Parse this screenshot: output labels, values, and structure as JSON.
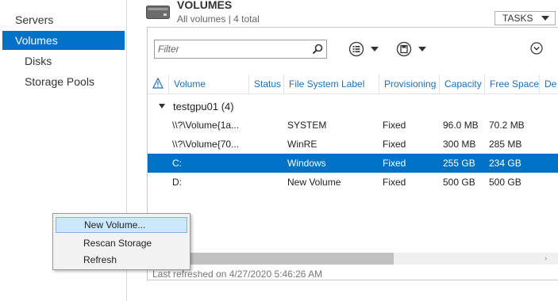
{
  "sidebar": {
    "items": [
      {
        "label": "Servers"
      },
      {
        "label": "Volumes"
      },
      {
        "label": "Disks"
      },
      {
        "label": "Storage Pools"
      }
    ]
  },
  "header": {
    "title": "VOLUMES",
    "subtitle": "All volumes | 4 total",
    "tasks_label": "TASKS"
  },
  "filter": {
    "placeholder": "Filter"
  },
  "columns": [
    "Volume",
    "Status",
    "File System Label",
    "Provisioning",
    "Capacity",
    "Free Space",
    "De"
  ],
  "group": {
    "label": "testgpu01 (4)"
  },
  "rows": [
    {
      "volume": "\\\\?\\Volume{1a...",
      "status": "",
      "label": "SYSTEM",
      "provisioning": "Fixed",
      "capacity": "96.0 MB",
      "free": "70.2 MB"
    },
    {
      "volume": "\\\\?\\Volume{70...",
      "status": "",
      "label": "WinRE",
      "provisioning": "Fixed",
      "capacity": "300 MB",
      "free": "285 MB"
    },
    {
      "volume": "C:",
      "status": "",
      "label": "Windows",
      "provisioning": "Fixed",
      "capacity": "255 GB",
      "free": "234 GB"
    },
    {
      "volume": "D:",
      "status": "",
      "label": "New Volume",
      "provisioning": "Fixed",
      "capacity": "500 GB",
      "free": "500 GB"
    }
  ],
  "footer": {
    "refreshed": "Last refreshed on 4/27/2020 5:46:26 AM"
  },
  "context_menu": {
    "items": [
      {
        "label": "New Volume..."
      },
      {
        "label": "Rescan Storage"
      },
      {
        "label": "Refresh"
      }
    ]
  },
  "colors": {
    "selection": "#0072c6",
    "header_text": "#1e6fb8",
    "menu_highlight": "#cce8ff"
  }
}
